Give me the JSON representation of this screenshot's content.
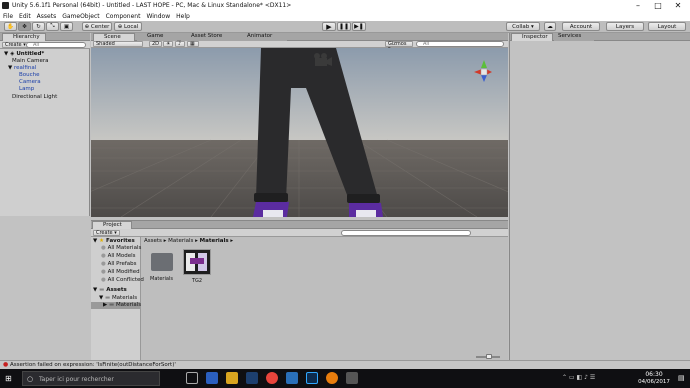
{
  "window": {
    "title": "Unity 5.6.1f1 Personal (64bit) - Untitled - LAST HOPE - PC, Mac & Linux Standalone* <DX11>",
    "minimize": "–",
    "maximize": "□",
    "close": "✕"
  },
  "menu": [
    "File",
    "Edit",
    "Assets",
    "GameObject",
    "Component",
    "Window",
    "Help"
  ],
  "toolbar": {
    "center": "Center",
    "local": "Local",
    "collab": "Collab ▾",
    "account": "Account",
    "layers": "Layers",
    "layout": "Layout"
  },
  "hierarchy": {
    "tab": "Hierarchy",
    "create": "Create ▾",
    "search_placeholder": "All",
    "scene": "Untitled*",
    "items": [
      "Main Camera",
      "realfinal",
      "Bouche",
      "Camera",
      "Lamp",
      "Directional Light"
    ]
  },
  "scene_tabs": {
    "scene": "Scene",
    "game": "Game",
    "asset_store": "Asset Store",
    "animator": "Animator"
  },
  "scene_toolbar": {
    "shading": "Shaded",
    "mode_2d": "2D",
    "gizmos": "Gizmos ▾",
    "search_placeholder": "All"
  },
  "inspector": {
    "tab": "Inspector",
    "services": "Services"
  },
  "project": {
    "tab": "Project",
    "create": "Create ▾",
    "breadcrumb": [
      "Assets",
      "Materials",
      "Materials"
    ],
    "favorites_label": "Favorites",
    "favorites": [
      "All Materials",
      "All Models",
      "All Prefabs",
      "All Modified",
      "All Conflicted"
    ],
    "assets_label": "Assets",
    "tree": [
      "Materials",
      "Materials"
    ],
    "grid_items": [
      "Materials",
      "TG2"
    ]
  },
  "status": {
    "message": "Assertion failed on expression: 'IsFinite(outDistanceForSort)'"
  },
  "taskbar": {
    "search_placeholder": "Taper ici pour rechercher",
    "time": "06:30",
    "date": "04/06/2017"
  },
  "colors": {
    "scene_sky": "#a9b3bc",
    "ground": "#5f5a56",
    "error": "#c62020"
  }
}
